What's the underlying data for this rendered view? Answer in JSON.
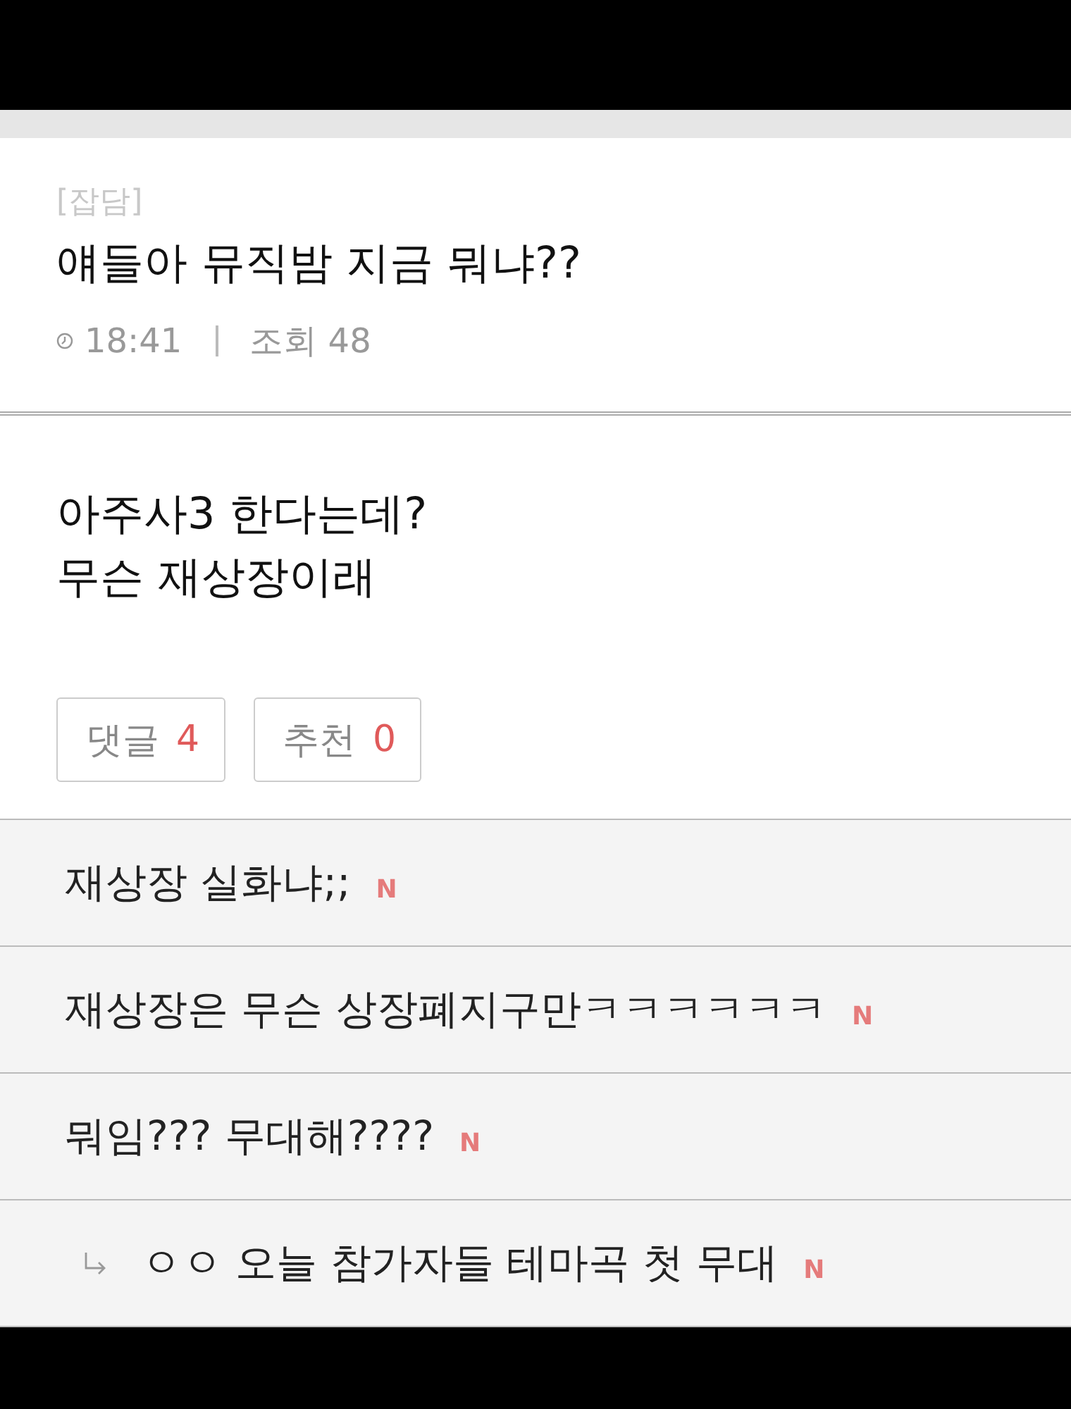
{
  "post": {
    "tag": "[잡담]",
    "title": "얘들아 뮤직밤 지금 뭐냐??",
    "time": "18:41",
    "views": "조회 48",
    "body": [
      "아주사3 한다는데?",
      "무슨 재상장이래"
    ],
    "buttons": [
      {
        "label": "댓글",
        "count": "4"
      },
      {
        "label": "추천",
        "count": "0"
      }
    ]
  },
  "comments": [
    {
      "text": "재상장 실화냐;;",
      "badge": "N"
    },
    {
      "text": "재상장은 무슨 상장폐지구만ㅋㅋㅋㅋㅋㅋ",
      "badge": "N"
    },
    {
      "text": "뭐임??? 무대해????",
      "badge": "N",
      "children": [
        {
          "text": "ㅇㅇ 오늘 참가자들 테마곡 첫 무대",
          "badge": "N"
        }
      ]
    }
  ]
}
